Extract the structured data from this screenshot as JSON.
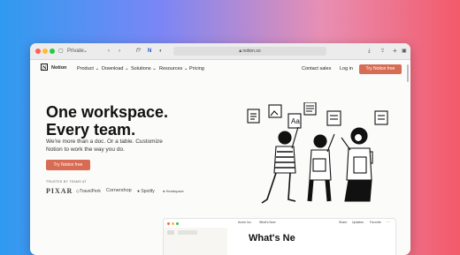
{
  "browser": {
    "tab_label": "Private",
    "address": "notion.so"
  },
  "nav": {
    "brand": "Notion",
    "items": [
      "Product ⌄",
      "Download ⌄",
      "Solutions ⌄",
      "Resources ⌄",
      "Pricing"
    ],
    "contact": "Contact sales",
    "login": "Log in",
    "cta": "Try Notion free"
  },
  "hero": {
    "headline_1": "One workspace.",
    "headline_2": "Every team.",
    "subhead": "We're more than a doc. Or a table. Customize Notion to work the way you do.",
    "cta": "Try Notion free",
    "trusted": "TRUSTED BY TEAMS AT",
    "logos": [
      "PIXAR",
      "TravelPerk",
      "Cornershop",
      "Spotify",
      "Headspace"
    ]
  },
  "preview": {
    "crumb_1": "Acme Inc.",
    "crumb_2": "What's New",
    "actions": [
      "Share",
      "Updates",
      "Favorite"
    ],
    "heading": "What's Ne"
  },
  "colors": {
    "accent": "#d76b53"
  }
}
